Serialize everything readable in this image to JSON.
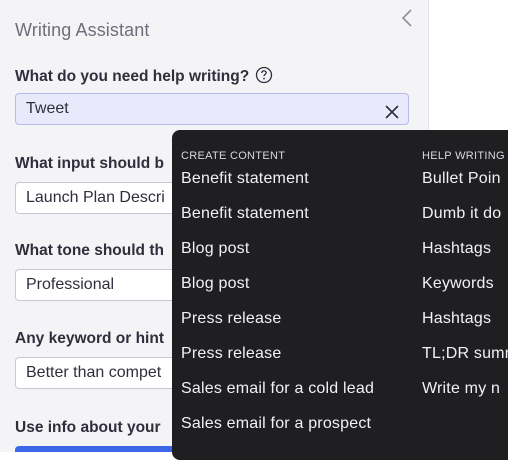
{
  "panel": {
    "title": "Writing Assistant",
    "collapse_icon": "chevron-left-icon"
  },
  "form": {
    "q1": {
      "label": "What do you need help writing?",
      "help_icon": "question-circle-icon",
      "value": "Tweet",
      "clear_icon": "close-icon"
    },
    "q2": {
      "label": "What input should b",
      "value": "Launch Plan Descri"
    },
    "q3": {
      "label": "What tone should th",
      "value": "Professional"
    },
    "q4": {
      "label": "Any keyword or hint",
      "value": "Better than compet"
    },
    "q5": {
      "label": "Use info about your"
    }
  },
  "dropdown": {
    "groups": [
      {
        "title": "CREATE CONTENT",
        "items": [
          "Benefit statement",
          "Benefit statement",
          "Blog post",
          "Blog post",
          "Press release",
          "Press release",
          "Sales email for a cold lead",
          "Sales email for a prospect"
        ]
      },
      {
        "title": "HELP WRITING",
        "items": [
          "Bullet Poin",
          "Dumb it do",
          "Hashtags",
          "Keywords",
          "Hashtags",
          "TL;DR summ",
          "Write my n"
        ]
      }
    ]
  },
  "colors": {
    "panel_bg": "#f4f4f6",
    "dropdown_bg": "#1f1f22",
    "active_field_bg": "#e8eafb",
    "primary": "#3c67e6"
  }
}
